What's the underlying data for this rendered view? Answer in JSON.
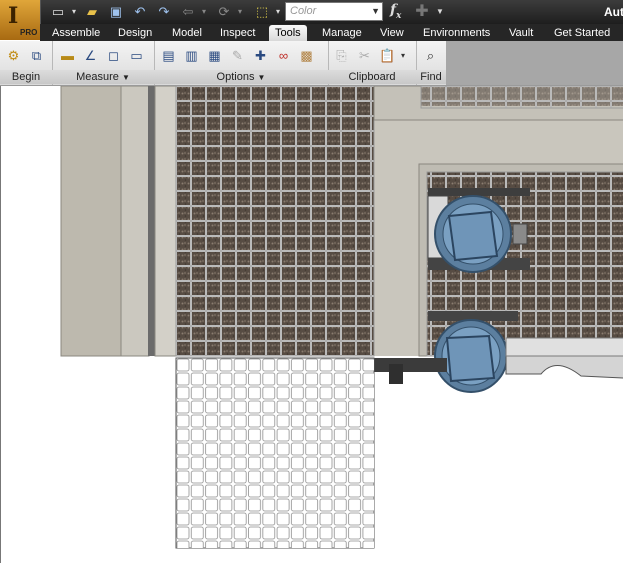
{
  "app": {
    "badge": "PRO",
    "title": "Aut"
  },
  "quick_access": {
    "icons": [
      "new-icon",
      "open-icon",
      "save-icon",
      "undo-icon",
      "redo-icon",
      "return-icon",
      "update-icon",
      "select-icon"
    ],
    "color_placeholder": "Color",
    "fx_label": "fx"
  },
  "tabs": [
    "Assemble",
    "Design",
    "Model",
    "Inspect",
    "Tools",
    "Manage",
    "View",
    "Environments",
    "Vault",
    "Get Started"
  ],
  "active_tab": "Tools",
  "ribbon": {
    "panels": [
      {
        "title": "Begin"
      },
      {
        "title": "Measure"
      },
      {
        "title": "Options"
      },
      {
        "title": "Clipboard"
      },
      {
        "title": "Find"
      }
    ]
  },
  "colors": {
    "floor": "#c9c6bd",
    "grating_dark": "#5c5249",
    "pump_blue": "#6e92b4",
    "grid_line": "#d8d8d8"
  }
}
